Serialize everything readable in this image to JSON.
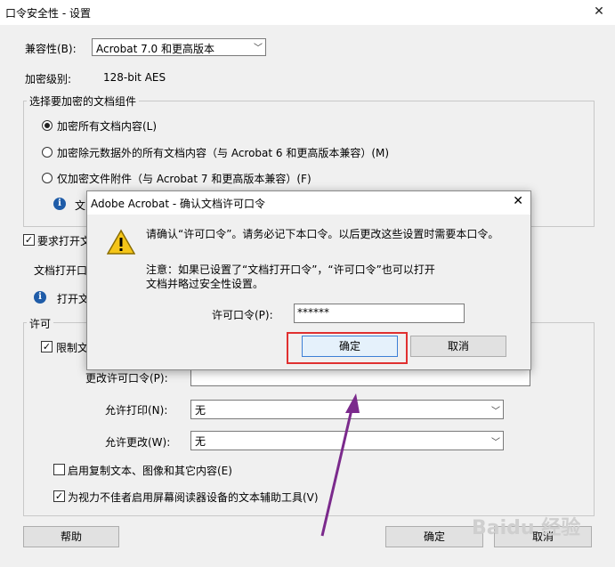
{
  "window": {
    "title": "口令安全性 - 设置"
  },
  "compatibility": {
    "label": "兼容性(B):",
    "value": "Acrobat 7.0 和更高版本"
  },
  "encryption_level": {
    "label": "加密级别:",
    "value": "128-bit AES"
  },
  "components_group": {
    "title": "选择要加密的文档组件",
    "options": [
      "加密所有文档内容(L)",
      "加密除元数据外的所有文档内容（与 Acrobat 6 和更高版本兼容）(M)",
      "仅加密文件附件（与 Acrobat 7 和更高版本兼容）(F)"
    ],
    "selected_index": 0,
    "info_text": "文"
  },
  "open_password": {
    "checkbox_label": "要求打开文",
    "field_label": "文档打开口",
    "info_text": "打开文"
  },
  "permissions_group": {
    "title": "许可",
    "restrict_label": "限制文",
    "change_password_label": "更改许可口令(P):",
    "print_label": "允许打印(N):",
    "print_value": "无",
    "changes_label": "允许更改(W):",
    "changes_value": "无",
    "copy_label": "启用复制文本、图像和其它内容(E)",
    "accessibility_label": "为视力不佳者启用屏幕阅读器设备的文本辅助工具(V)"
  },
  "bottom_buttons": {
    "help": "帮助",
    "ok": "确定",
    "cancel": "取消"
  },
  "modal": {
    "title": "Adobe Acrobat - 确认文档许可口令",
    "message": "请确认“许可口令”。请务必记下本口令。以后更改这些设置时需要本口令。",
    "note": "注意：如果已设置了“文档打开口令”，“许可口令”也可以打开文档并略过安全性设置。",
    "field_label": "许可口令(P):",
    "field_value": "******",
    "ok_label": "确定",
    "cancel_label": "取消"
  },
  "annotation": {
    "arrow_color": "#7b2a8c",
    "highlight_color": "#e03030"
  },
  "watermark": {
    "text": "Baidu 经验"
  }
}
